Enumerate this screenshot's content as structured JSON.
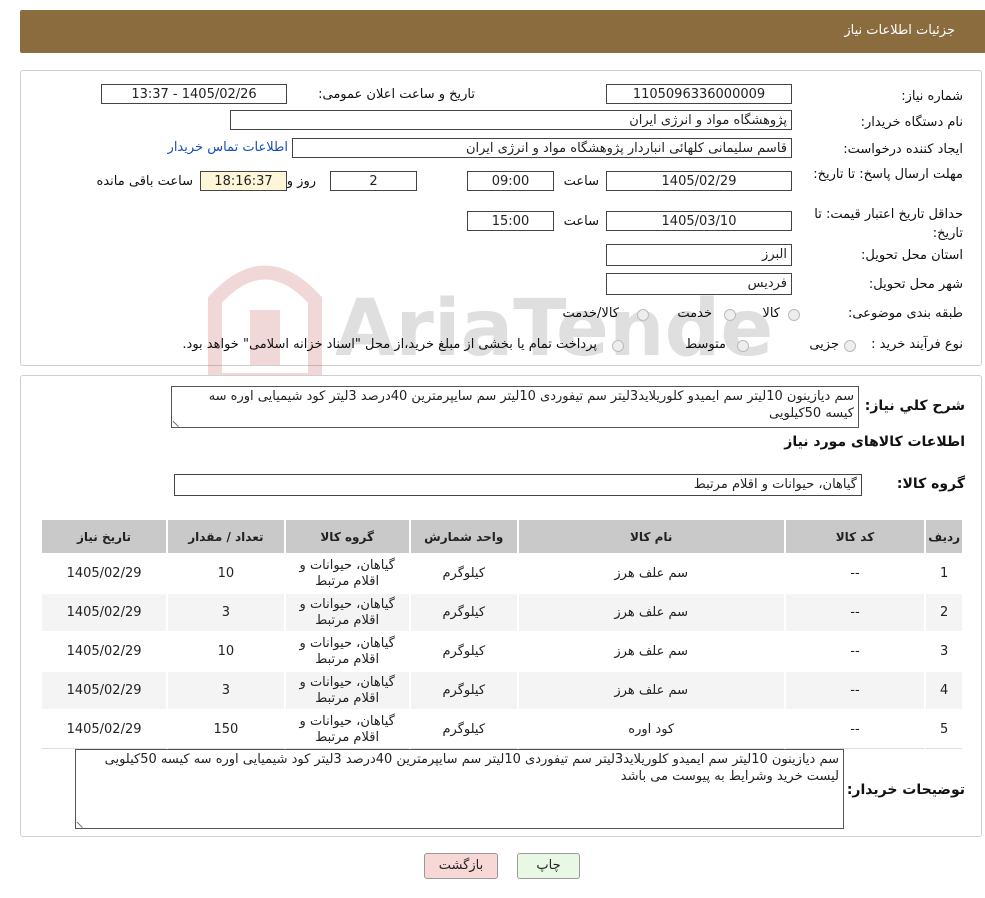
{
  "header": {
    "title": "جزئیات اطلاعات نیاز"
  },
  "form": {
    "need_number_label": "شماره نیاز:",
    "need_number": "1105096336000009",
    "announce_label": "تاریخ و ساعت اعلان عمومی:",
    "announce_value": "1405/02/26 - 13:37",
    "buyer_org_label": "نام دستگاه خریدار:",
    "buyer_org": "پژوهشگاه مواد و انرژی ایران",
    "requester_label": "ایجاد کننده درخواست:",
    "requester": "قاسم سلیمانی کلهائی انباردار پژوهشگاه مواد و انرژی ایران",
    "contact_link": "اطلاعات تماس خریدار",
    "deadline_label": "مهلت ارسال پاسخ: تا تاریخ:",
    "deadline_date": "1405/02/29",
    "time_label": "ساعت",
    "deadline_time": "09:00",
    "days_value": "2",
    "days_label": "روز و",
    "remaining_time": "18:16:37",
    "remaining_label": "ساعت باقی مانده",
    "validity_label": "حداقل تاریخ اعتبار قیمت: تا تاریخ:",
    "validity_date": "1405/03/10",
    "validity_time": "15:00",
    "province_label": "استان محل تحویل:",
    "province": "البرز",
    "city_label": "شهر محل تحویل:",
    "city": "فردیس",
    "category_label": "طبقه بندی موضوعی:",
    "category_options": [
      "کالا",
      "خدمت",
      "کالا/خدمت"
    ],
    "process_label": "نوع فرآیند خرید :",
    "process_options": [
      "جزیی",
      "متوسط"
    ],
    "process_note": "پرداخت تمام یا بخشی از مبلغ خرید،از محل \"اسناد خزانه اسلامی\" خواهد بود."
  },
  "watermark": "AriaTender.neT",
  "summary": {
    "label": "شرح کلي نياز:",
    "text": "سم دیازینون  10لیتر سم ایمیدو کلوریلاید3لیتر سم تیفوردی 10لیتر سم سایپرمترین 40درصد 3لیتر  کود شیمیایی اوره سه کیسه 50کیلویی"
  },
  "goods_title": "اطلاعات کالاهای مورد نیاز",
  "goods_group": {
    "label": "گروه کالا:",
    "value": "گیاهان، حیوانات و اقلام مرتبط"
  },
  "table": {
    "headers": [
      "ردیف",
      "کد کالا",
      "نام کالا",
      "واحد شمارش",
      "گروه کالا",
      "تعداد / مقدار",
      "تاریخ نیاز"
    ],
    "rows": [
      [
        "1",
        "--",
        "سم علف هرز",
        "کیلوگرم",
        "گیاهان، حیوانات و اقلام مرتبط",
        "10",
        "1405/02/29"
      ],
      [
        "2",
        "--",
        "سم علف هرز",
        "کیلوگرم",
        "گیاهان، حیوانات و اقلام مرتبط",
        "3",
        "1405/02/29"
      ],
      [
        "3",
        "--",
        "سم علف هرز",
        "کیلوگرم",
        "گیاهان، حیوانات و اقلام مرتبط",
        "10",
        "1405/02/29"
      ],
      [
        "4",
        "--",
        "سم علف هرز",
        "کیلوگرم",
        "گیاهان، حیوانات و اقلام مرتبط",
        "3",
        "1405/02/29"
      ],
      [
        "5",
        "--",
        "کود اوره",
        "کیلوگرم",
        "گیاهان، حیوانات و اقلام مرتبط",
        "150",
        "1405/02/29"
      ]
    ]
  },
  "buyer_notes": {
    "label": "توضیحات خریدار:",
    "line1": "سم دیازینون  10لیتر سم ایمیدو کلوریلاید3لیتر سم تیفوردی 10لیتر سم سایپرمترین 40درصد 3لیتر  کود شیمیایی اوره سه کیسه 50کیلویی",
    "line2": "لیست خرید وشرایط به پیوست می باشد"
  },
  "buttons": {
    "print": "چاپ",
    "back": "بازگشت"
  },
  "colors": {
    "header_bg": "#8b6c3f",
    "back_button_bg": "#f8d7d7",
    "print_button_bg": "#e9f8e5"
  }
}
